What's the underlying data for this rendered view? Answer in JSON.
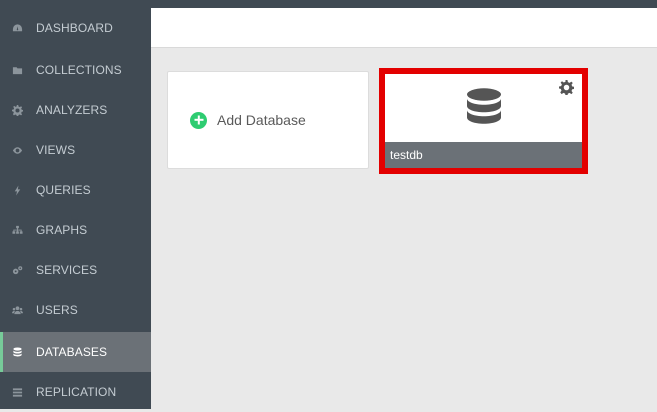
{
  "sidebar": {
    "items": [
      {
        "label": "DASHBOARD",
        "icon": "dashboard-icon",
        "active": false
      },
      {
        "label": "COLLECTIONS",
        "icon": "folder-icon",
        "active": false
      },
      {
        "label": "ANALYZERS",
        "icon": "gear-icon",
        "active": false
      },
      {
        "label": "VIEWS",
        "icon": "eye-icon",
        "active": false
      },
      {
        "label": "QUERIES",
        "icon": "bolt-icon",
        "active": false
      },
      {
        "label": "GRAPHS",
        "icon": "sitemap-icon",
        "active": false
      },
      {
        "label": "SERVICES",
        "icon": "cogs-icon",
        "active": false
      },
      {
        "label": "USERS",
        "icon": "users-icon",
        "active": false
      },
      {
        "label": "DATABASES",
        "icon": "database-icon",
        "active": true
      },
      {
        "label": "REPLICATION",
        "icon": "replication-icon",
        "active": false
      }
    ]
  },
  "main": {
    "add_database_label": "Add Database",
    "databases": [
      {
        "name": "testdb",
        "highlighted": true
      }
    ]
  },
  "colors": {
    "sidebar_bg": "#404a53",
    "active_item_bg": "#6b7177",
    "accent_green": "#2ecc71",
    "highlight_red": "#e30000"
  }
}
